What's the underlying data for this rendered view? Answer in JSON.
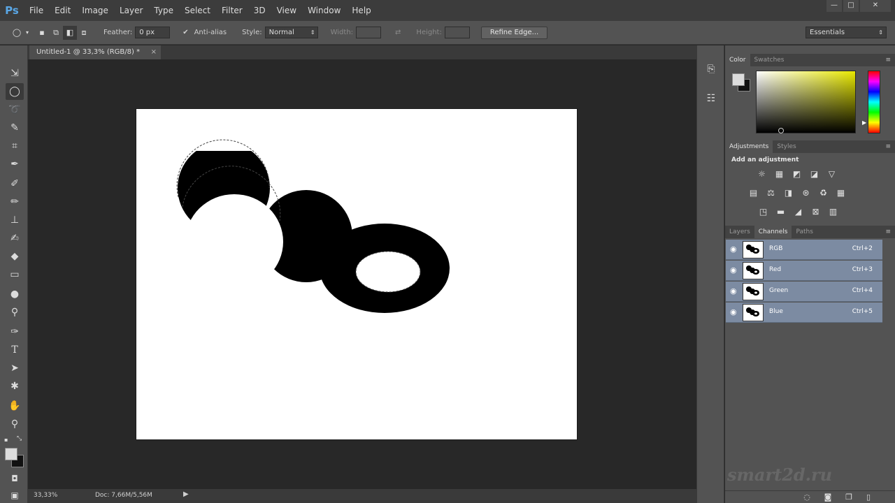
{
  "app": {
    "logo": "Ps",
    "menu": [
      "File",
      "Edit",
      "Image",
      "Layer",
      "Type",
      "Select",
      "Filter",
      "3D",
      "View",
      "Window",
      "Help"
    ],
    "window_controls": [
      "—",
      "□",
      "✕"
    ]
  },
  "options_bar": {
    "feather_label": "Feather:",
    "feather_value": "0 px",
    "anti_alias_label": "Anti-alias",
    "style_label": "Style:",
    "style_value": "Normal",
    "width_label": "Width:",
    "height_label": "Height:",
    "refine_edge_label": "Refine Edge...",
    "workspace_value": "Essentials"
  },
  "document": {
    "tab_title": "Untitled-1 @ 33,3% (RGB/8) *",
    "tab_close": "×"
  },
  "status": {
    "zoom": "33,33%",
    "doc_size": "Doc: 7,66M/5,56M",
    "arrow": "▶"
  },
  "panels": {
    "color_tabs": [
      "Color",
      "Swatches"
    ],
    "adjustment_tabs": [
      "Adjustments",
      "Styles"
    ],
    "adjustment_title": "Add an adjustment",
    "channel_tabs": [
      "Layers",
      "Channels",
      "Paths"
    ],
    "channels": [
      {
        "name": "RGB",
        "shortcut": "Ctrl+2"
      },
      {
        "name": "Red",
        "shortcut": "Ctrl+3"
      },
      {
        "name": "Green",
        "shortcut": "Ctrl+4"
      },
      {
        "name": "Blue",
        "shortcut": "Ctrl+5"
      }
    ],
    "panel_menu": "≡"
  },
  "watermark": "smart2d.ru",
  "colors": {
    "foreground": "#dcdcdc",
    "background": "#111111",
    "selection_row": "#7c8ba2",
    "canvas_bg": "#282828",
    "panel_bg": "#535353"
  },
  "tool_icons": [
    "move-icon",
    "elliptical-marquee-icon",
    "lasso-icon",
    "quick-selection-icon",
    "crop-icon",
    "eyedropper-icon",
    "healing-brush-icon",
    "brush-icon",
    "clone-stamp-icon",
    "history-brush-icon",
    "eraser-icon",
    "gradient-icon",
    "blur-icon",
    "dodge-icon",
    "pen-icon",
    "type-icon",
    "path-selection-icon",
    "shape-icon",
    "hand-icon",
    "zoom-icon"
  ]
}
